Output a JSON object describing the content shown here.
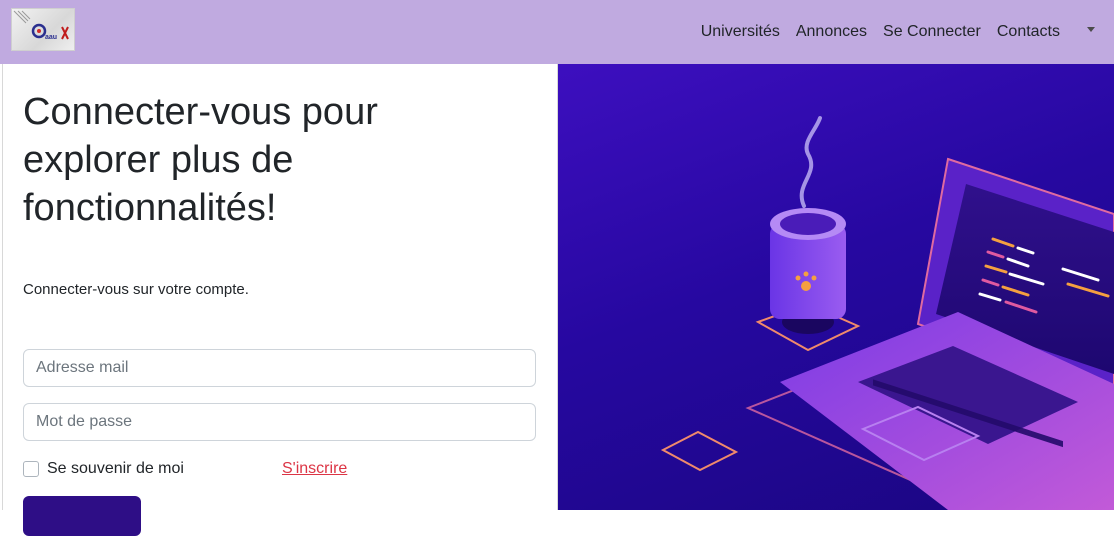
{
  "navbar": {
    "logo_name": "logo-image",
    "links": [
      {
        "label": "Universités"
      },
      {
        "label": "Annonces"
      },
      {
        "label": "Se Connecter"
      },
      {
        "label": "Contacts"
      }
    ],
    "background_color": "#c0aae0"
  },
  "login": {
    "heading": "Connecter-vous pour explorer plus de fonctionnalités!",
    "subtext": "Connecter-vous sur votre compte.",
    "email_placeholder": "Adresse mail",
    "password_placeholder": "Mot de passe",
    "remember_label": "Se souvenir de moi",
    "signup_link": "S'inscrire",
    "submit_color": "#2e0e86",
    "signup_color": "#dc3545"
  },
  "illustration": {
    "description_icon": "laptop-coffee-illustration",
    "background_color": "#2a0aa8"
  }
}
